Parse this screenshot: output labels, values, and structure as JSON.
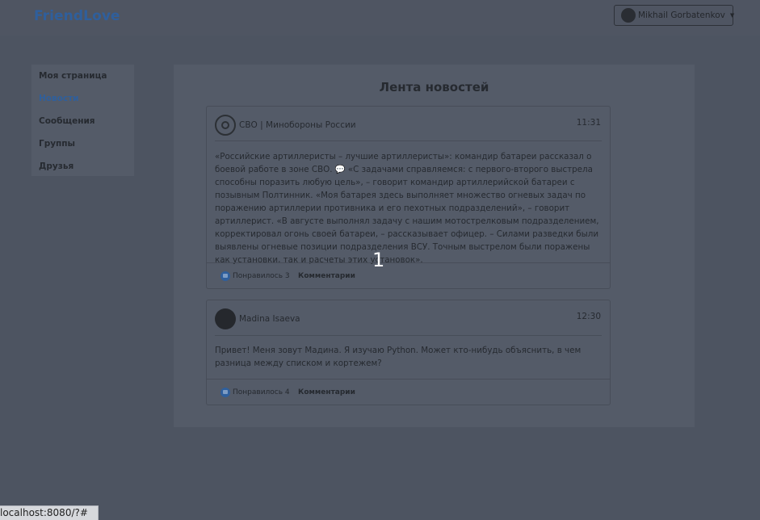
{
  "app": {
    "brand": "FriendLove"
  },
  "user": {
    "name": "Mikhail Gorbatenkov"
  },
  "sidebar": {
    "items": [
      {
        "label": "Моя страница",
        "active": false
      },
      {
        "label": "Новости",
        "active": true
      },
      {
        "label": "Сообщения",
        "active": false
      },
      {
        "label": "Группы",
        "active": false
      },
      {
        "label": "Друзья",
        "active": false
      }
    ]
  },
  "feed": {
    "title": "Лента новостей",
    "posts": [
      {
        "author": "СВО | Минобороны России",
        "avatar_icon": "emblem-icon",
        "time": "11:31",
        "text": "«Российские артиллеристы – лучшие артиллеристы»: командир батареи рассказал о боевой работе в зоне СВО. 💬 «С задачами справляемся: с первого-второго выстрела способны поразить любую цель», – говорит командир артиллерийской батареи с позывным Полтинник. «Моя батарея здесь выполняет множество огневых задач по поражению артиллерии противника и его пехотных подразделений», – говорит артиллерист. «В августе выполнял задачу с нашим мотострелковым подразделением, корректировал огонь своей батареи, – рассказывает офицер. – Силами разведки были выявлены огневые позиции подразделения ВСУ. Точным выстрелом были поражены как установки, так и расчеты этих установок».",
        "likes_label": "Понравилось 3",
        "comments_label": "Комментарии"
      },
      {
        "author": "Madina Isaeva",
        "avatar_icon": "user-photo-icon",
        "time": "12:30",
        "text": "Привет! Меня зовут Мадина. Я изучаю Python. Может кто-нибудь объяснить, в чем разница между списком и кортежем?",
        "likes_label": "Понравилось 4",
        "comments_label": "Комментарии"
      }
    ]
  },
  "overlay": {
    "page_number": "1"
  },
  "status_bar": {
    "url": "localhost:8080/?#"
  },
  "colors": {
    "accent": "#2f5f9c",
    "background": "#4d5461"
  }
}
